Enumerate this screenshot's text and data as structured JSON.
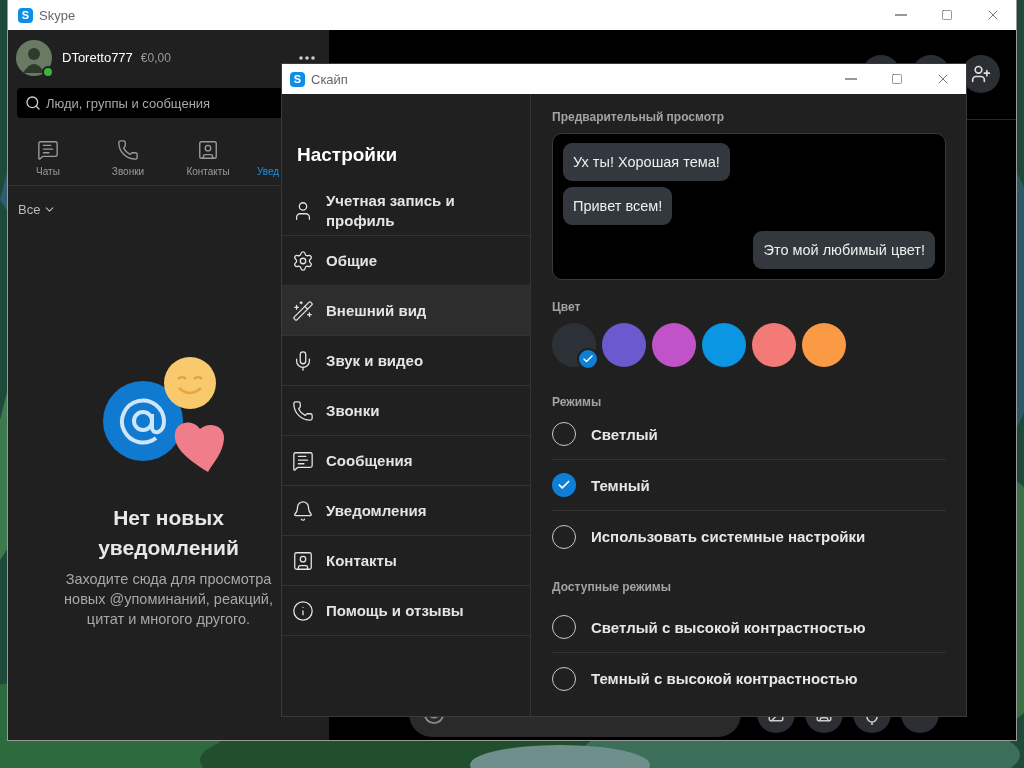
{
  "main_window": {
    "logo": "S",
    "title": "Skype",
    "profile": {
      "name": "DToretto777",
      "balance": "€0,00",
      "online": true
    },
    "search": {
      "placeholder": "Люди, группы и сообщения"
    },
    "tabs": [
      {
        "label": "Чаты",
        "kind": "chats",
        "selected": false
      },
      {
        "label": "Звонки",
        "kind": "calls",
        "selected": false
      },
      {
        "label": "Контакты",
        "kind": "contacts",
        "selected": false
      },
      {
        "label": "Увед",
        "kind": "notifications",
        "selected": true
      }
    ],
    "filter": "Все",
    "empty_state": {
      "title": "Нет новых уведомлений",
      "text": "Заходите сюда для просмотра новых @упоминаний, реакций, цитат и многого другого."
    }
  },
  "settings_window": {
    "logo": "S",
    "title": "Скайп",
    "heading": "Настройки",
    "nav": [
      {
        "label": "Учетная запись и профиль",
        "kind": "account",
        "selected": false
      },
      {
        "label": "Общие",
        "kind": "general",
        "selected": false
      },
      {
        "label": "Внешний вид",
        "kind": "appearance",
        "selected": true
      },
      {
        "label": "Звук и видео",
        "kind": "audio",
        "selected": false
      },
      {
        "label": "Звонки",
        "kind": "calls",
        "selected": false
      },
      {
        "label": "Сообщения",
        "kind": "messages",
        "selected": false
      },
      {
        "label": "Уведомления",
        "kind": "notifications",
        "selected": false
      },
      {
        "label": "Контакты",
        "kind": "contacts",
        "selected": false
      },
      {
        "label": "Помощь и отзывы",
        "kind": "help",
        "selected": false
      }
    ],
    "preview": {
      "title": "Предварительный просмотр",
      "messages": [
        {
          "text": "Ух ты! Хорошая тема!",
          "outgoing": false
        },
        {
          "text": "Привет всем!",
          "outgoing": false
        },
        {
          "text": "Это мой любимый цвет!",
          "outgoing": true
        }
      ]
    },
    "colors": {
      "title": "Цвет",
      "swatches": [
        {
          "color": "#2b3137",
          "selected": true
        },
        {
          "color": "#6a5acd",
          "selected": false
        },
        {
          "color": "#c153c8",
          "selected": false
        },
        {
          "color": "#0a96e2",
          "selected": false
        },
        {
          "color": "#f47a78",
          "selected": false
        },
        {
          "color": "#fb9a45",
          "selected": false
        }
      ]
    },
    "modes": {
      "title": "Режимы",
      "options": [
        {
          "label": "Светлый",
          "selected": false
        },
        {
          "label": "Темный",
          "selected": true
        },
        {
          "label": "Использовать системные настройки",
          "selected": false
        }
      ]
    },
    "available_modes": {
      "title": "Доступные режимы",
      "options": [
        {
          "label": "Светлый с высокой контрастностью",
          "selected": false
        },
        {
          "label": "Темный с высокой контрастностью",
          "selected": false
        }
      ]
    }
  }
}
